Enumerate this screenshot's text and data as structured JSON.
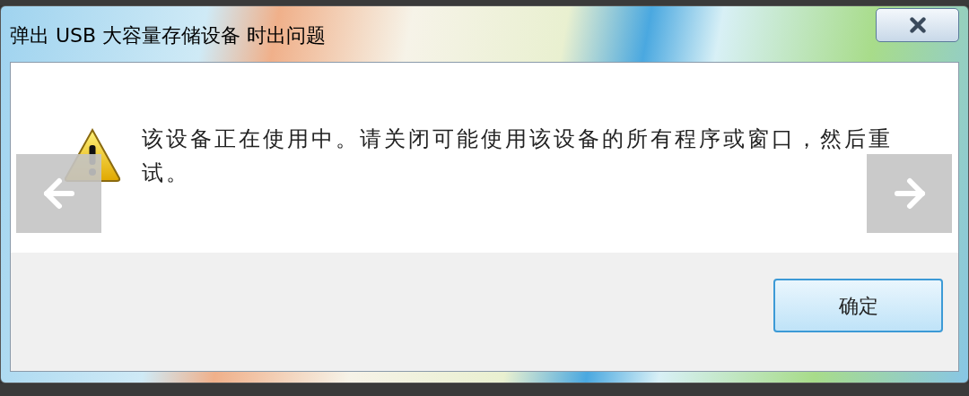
{
  "window": {
    "title": "弹出 USB 大容量存储设备 时出问题"
  },
  "message": "该设备正在使用中。请关闭可能使用该设备的所有程序或窗口，然后重试。",
  "buttons": [
    {
      "label": "确定",
      "default": true
    }
  ]
}
